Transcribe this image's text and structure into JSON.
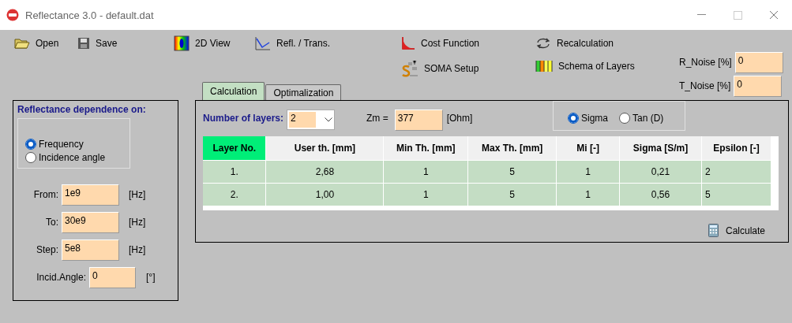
{
  "window": {
    "title": "Reflectance 3.0 - default.dat"
  },
  "toolbar": [
    {
      "kind": "open",
      "label": "Open"
    },
    {
      "kind": "save",
      "label": "Save"
    },
    {
      "kind": "view2d",
      "label": "2D View"
    },
    {
      "kind": "refl",
      "label": "Refl. / Trans."
    },
    {
      "kind": "cost",
      "label": "Cost Function"
    },
    {
      "kind": "recalc",
      "label": "Recalculation"
    },
    {
      "kind": "soma",
      "label": "SOMA Setup"
    },
    {
      "kind": "schema",
      "label": "Schema of Layers"
    }
  ],
  "noise": [
    {
      "label": "R_Noise [%]",
      "value": "0"
    },
    {
      "label": "T_Noise [%]",
      "value": "0"
    }
  ],
  "tabs": [
    {
      "label": "Calculation",
      "selected": true
    },
    {
      "label": "Optimalization",
      "selected": false
    }
  ],
  "dependence": {
    "title": "Reflectance dependence on:",
    "options": [
      {
        "label": "Frequency",
        "selected": true
      },
      {
        "label": "Incidence angle",
        "selected": false
      }
    ],
    "fields": [
      {
        "label": "From:",
        "value": "1e9",
        "unit": "[Hz]"
      },
      {
        "label": "To:",
        "value": "30e9",
        "unit": "[Hz]"
      },
      {
        "label": "Step:",
        "value": "5e8",
        "unit": "[Hz]"
      },
      {
        "label": "Incid.Angle:",
        "value": "0",
        "unit": "[°]"
      }
    ]
  },
  "calculation": {
    "layers_label": "Number of layers:",
    "layers_value": "2",
    "zm_label": "Zm =",
    "zm_value": "377",
    "zm_unit": "[Ohm]",
    "mode": [
      {
        "label": "Sigma",
        "selected": true
      },
      {
        "label": "Tan (D)",
        "selected": false
      }
    ],
    "table": {
      "columns": [
        "Layer No.",
        "User th. [mm]",
        "Min Th. [mm]",
        "Max Th. [mm]",
        "Mi [-]",
        "Sigma [S/m]",
        "Epsilon [-]"
      ],
      "rows": [
        [
          "1.",
          "2,68",
          "1",
          "5",
          "1",
          "0,21",
          "2"
        ],
        [
          "2.",
          "1,00",
          "1",
          "5",
          "1",
          "0,56",
          "5"
        ]
      ]
    },
    "calculate": "Calculate"
  }
}
